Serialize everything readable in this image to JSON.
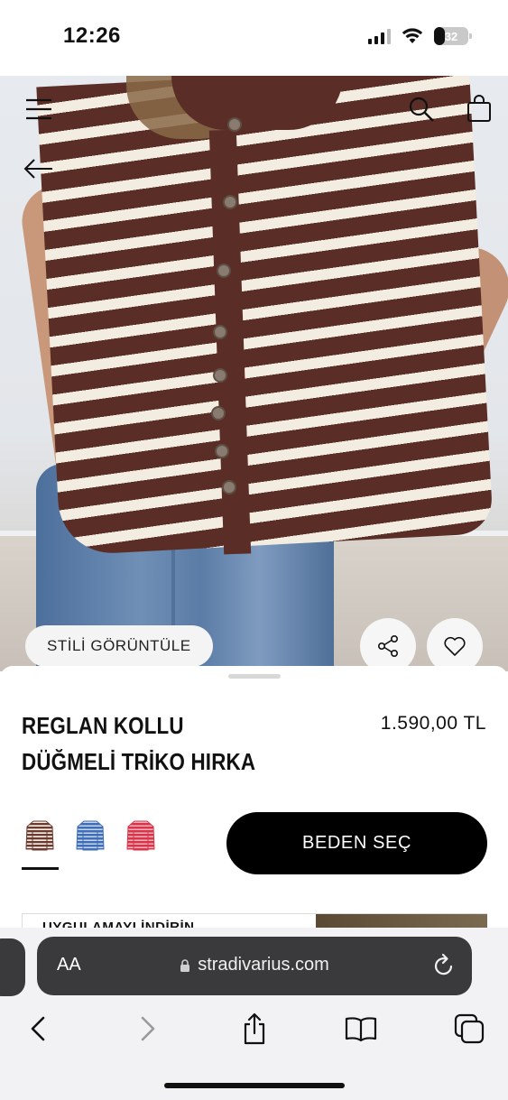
{
  "status_bar": {
    "time": "12:26",
    "battery_percent": "32",
    "icons": [
      "signal-icon",
      "wifi-icon",
      "battery-icon"
    ]
  },
  "hero": {
    "icons": [
      "menu-icon",
      "search-icon",
      "shopping-bag-icon",
      "back-arrow-icon",
      "share-icon",
      "heart-icon"
    ],
    "style_button_label": "STİLİ GÖRÜNTÜLE"
  },
  "product": {
    "title": "REGLAN KOLLU DÜĞMELİ TRİKO HIRKA",
    "price": "1.590,00 TL",
    "size_button_label": "BEDEN SEÇ",
    "swatches": [
      {
        "name": "brown-stripe",
        "color": "#6b3a30",
        "accent": "#f2ebe0",
        "selected": true
      },
      {
        "name": "blue-stripe",
        "color": "#3f6db6",
        "accent": "#c6d6f0",
        "selected": false
      },
      {
        "name": "red-stripe",
        "color": "#d8344a",
        "accent": "#f6b0bb",
        "selected": false
      }
    ],
    "peek_text": "UYGULAMAYI İNDİRİN"
  },
  "browser": {
    "text_size_label": "AA",
    "url": "stradivarius.com",
    "toolbar": [
      "back-icon",
      "forward-icon",
      "share-icon",
      "bookmarks-icon",
      "tabs-icon"
    ]
  },
  "colors": {
    "primary_button": "#000000",
    "address_bar": "#3a3a3c",
    "toolbar_bg": "#f2f2f4"
  }
}
